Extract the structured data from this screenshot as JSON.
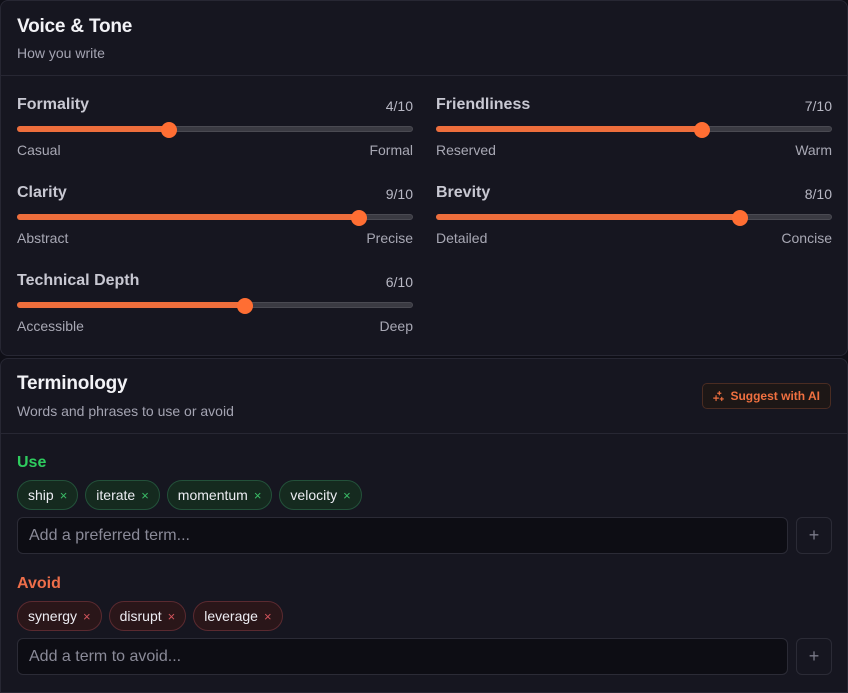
{
  "voice": {
    "title": "Voice & Tone",
    "subtitle": "How you write",
    "sliders": [
      {
        "label": "Formality",
        "value": 4,
        "max": 10,
        "display": "4/10",
        "min_label": "Casual",
        "max_label": "Formal"
      },
      {
        "label": "Friendliness",
        "value": 7,
        "max": 10,
        "display": "7/10",
        "min_label": "Reserved",
        "max_label": "Warm"
      },
      {
        "label": "Clarity",
        "value": 9,
        "max": 10,
        "display": "9/10",
        "min_label": "Abstract",
        "max_label": "Precise"
      },
      {
        "label": "Brevity",
        "value": 8,
        "max": 10,
        "display": "8/10",
        "min_label": "Detailed",
        "max_label": "Concise"
      },
      {
        "label": "Technical Depth",
        "value": 6,
        "max": 10,
        "display": "6/10",
        "min_label": "Accessible",
        "max_label": "Deep"
      }
    ]
  },
  "terminology": {
    "title": "Terminology",
    "subtitle": "Words and phrases to use or avoid",
    "suggest_label": "Suggest with AI",
    "use": {
      "label": "Use",
      "terms": [
        "ship",
        "iterate",
        "momentum",
        "velocity"
      ],
      "placeholder": "Add a preferred term...",
      "add_label": "+"
    },
    "avoid": {
      "label": "Avoid",
      "terms": [
        "synergy",
        "disrupt",
        "leverage"
      ],
      "placeholder": "Add a term to avoid...",
      "add_label": "+"
    },
    "remove_glyph": "×"
  },
  "colors": {
    "accent": "#ee6e3c",
    "use_green": "#2ecc5e",
    "avoid_red": "#ee6e4a"
  }
}
